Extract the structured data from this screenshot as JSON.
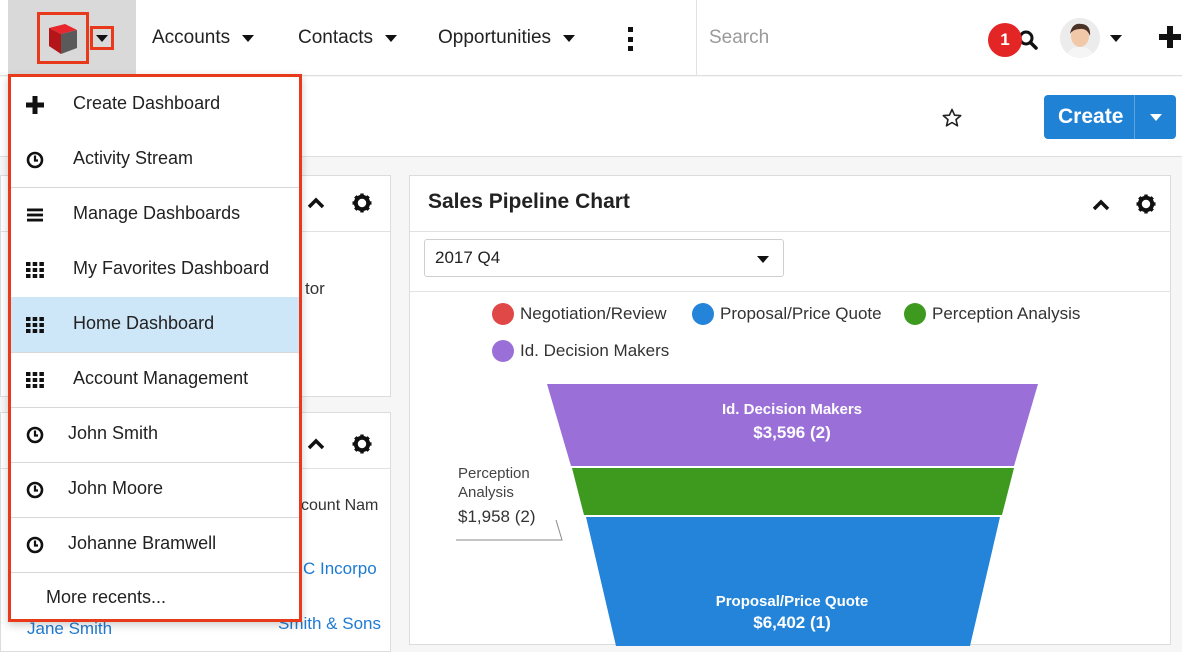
{
  "nav": {
    "items": [
      "Accounts",
      "Contacts",
      "Opportunities"
    ],
    "search_placeholder": "Search",
    "notification_count": "1"
  },
  "header": {
    "create_label": "Create"
  },
  "left_dashlets": {
    "partial_text_1": "tor",
    "column_header": "count Nam",
    "row1_link": "C Incorpo",
    "row2_left": "Jane Smith",
    "row2_right": "Smith & Sons"
  },
  "chart": {
    "title": "Sales Pipeline Chart",
    "period": "2017 Q4",
    "legend": [
      {
        "label": "Negotiation/Review",
        "color": "#e04848"
      },
      {
        "label": "Proposal/Price Quote",
        "color": "#2384d9"
      },
      {
        "label": "Perception Analysis",
        "color": "#3d9a1f"
      },
      {
        "label": "Id. Decision Makers",
        "color": "#9b6fd8"
      }
    ],
    "annotation": [
      "Perception",
      "Analysis",
      "$1,958 (2)"
    ]
  },
  "chart_data": {
    "type": "funnel",
    "stages": [
      {
        "name": "Id. Decision Makers",
        "amount": "$3,596",
        "count": 2,
        "color": "#9b6fd8"
      },
      {
        "name": "Perception Analysis",
        "amount": "$1,958",
        "count": 2,
        "color": "#3d9a1f"
      },
      {
        "name": "Proposal/Price Quote",
        "amount": "$6,402",
        "count": 1,
        "color": "#2384d9"
      }
    ]
  },
  "menu": {
    "items": [
      {
        "label": "Create Dashboard",
        "icon": "plus-icon"
      },
      {
        "label": "Activity Stream",
        "icon": "clock-icon"
      },
      {
        "label": "Manage Dashboards",
        "icon": "list-icon"
      },
      {
        "label": "My Favorites Dashboard",
        "icon": "grid-icon"
      },
      {
        "label": "Home Dashboard",
        "icon": "grid-icon",
        "active": true
      },
      {
        "label": "Account Management",
        "icon": "grid-icon"
      },
      {
        "label": "John Smith",
        "icon": "clock-icon"
      },
      {
        "label": "John Moore",
        "icon": "clock-icon"
      },
      {
        "label": "Johanne Bramwell",
        "icon": "clock-icon"
      }
    ],
    "more_label": "More recents..."
  }
}
